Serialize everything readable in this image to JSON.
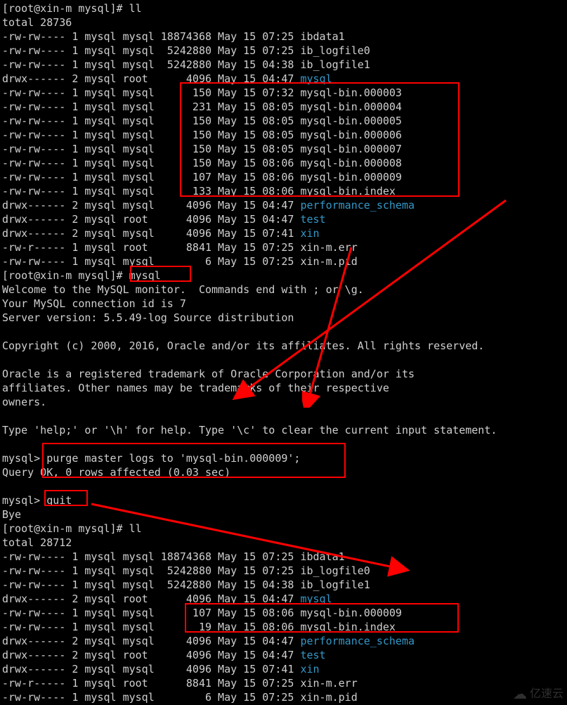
{
  "prompt1": "[root@xin-m mysql]# ll",
  "total1": "total 28736",
  "ls1": [
    {
      "perm": "-rw-rw----",
      "lnk": "1",
      "own": "mysql",
      "grp": "mysql",
      "size": "18874368",
      "date": "May 15 07:25",
      "name": "ibdata1",
      "dir": false
    },
    {
      "perm": "-rw-rw----",
      "lnk": "1",
      "own": "mysql",
      "grp": "mysql",
      "size": "5242880",
      "date": "May 15 07:25",
      "name": "ib_logfile0",
      "dir": false
    },
    {
      "perm": "-rw-rw----",
      "lnk": "1",
      "own": "mysql",
      "grp": "mysql",
      "size": "5242880",
      "date": "May 15 04:38",
      "name": "ib_logfile1",
      "dir": false
    },
    {
      "perm": "drwx------",
      "lnk": "2",
      "own": "mysql",
      "grp": "root",
      "size": "4096",
      "date": "May 15 04:47",
      "name": "mysql",
      "dir": true
    },
    {
      "perm": "-rw-rw----",
      "lnk": "1",
      "own": "mysql",
      "grp": "mysql",
      "size": "150",
      "date": "May 15 07:32",
      "name": "mysql-bin.000003",
      "dir": false
    },
    {
      "perm": "-rw-rw----",
      "lnk": "1",
      "own": "mysql",
      "grp": "mysql",
      "size": "231",
      "date": "May 15 08:05",
      "name": "mysql-bin.000004",
      "dir": false
    },
    {
      "perm": "-rw-rw----",
      "lnk": "1",
      "own": "mysql",
      "grp": "mysql",
      "size": "150",
      "date": "May 15 08:05",
      "name": "mysql-bin.000005",
      "dir": false
    },
    {
      "perm": "-rw-rw----",
      "lnk": "1",
      "own": "mysql",
      "grp": "mysql",
      "size": "150",
      "date": "May 15 08:05",
      "name": "mysql-bin.000006",
      "dir": false
    },
    {
      "perm": "-rw-rw----",
      "lnk": "1",
      "own": "mysql",
      "grp": "mysql",
      "size": "150",
      "date": "May 15 08:05",
      "name": "mysql-bin.000007",
      "dir": false
    },
    {
      "perm": "-rw-rw----",
      "lnk": "1",
      "own": "mysql",
      "grp": "mysql",
      "size": "150",
      "date": "May 15 08:06",
      "name": "mysql-bin.000008",
      "dir": false
    },
    {
      "perm": "-rw-rw----",
      "lnk": "1",
      "own": "mysql",
      "grp": "mysql",
      "size": "107",
      "date": "May 15 08:06",
      "name": "mysql-bin.000009",
      "dir": false
    },
    {
      "perm": "-rw-rw----",
      "lnk": "1",
      "own": "mysql",
      "grp": "mysql",
      "size": "133",
      "date": "May 15 08:06",
      "name": "mysql-bin.index",
      "dir": false
    },
    {
      "perm": "drwx------",
      "lnk": "2",
      "own": "mysql",
      "grp": "mysql",
      "size": "4096",
      "date": "May 15 04:47",
      "name": "performance_schema",
      "dir": true
    },
    {
      "perm": "drwx------",
      "lnk": "2",
      "own": "mysql",
      "grp": "root",
      "size": "4096",
      "date": "May 15 04:47",
      "name": "test",
      "dir": true
    },
    {
      "perm": "drwx------",
      "lnk": "2",
      "own": "mysql",
      "grp": "mysql",
      "size": "4096",
      "date": "May 15 07:41",
      "name": "xin",
      "dir": true
    },
    {
      "perm": "-rw-r-----",
      "lnk": "1",
      "own": "mysql",
      "grp": "root",
      "size": "8841",
      "date": "May 15 07:25",
      "name": "xin-m.err",
      "dir": false
    },
    {
      "perm": "-rw-rw----",
      "lnk": "1",
      "own": "mysql",
      "grp": "mysql",
      "size": "6",
      "date": "May 15 07:25",
      "name": "xin-m.pid",
      "dir": false
    }
  ],
  "prompt2_pre": "[root@xin-m mysql]# ",
  "prompt2_cmd": "mysql",
  "welcome": [
    "Welcome to the MySQL monitor.  Commands end with ; or \\g.",
    "Your MySQL connection id is 7",
    "Server version: 5.5.49-log Source distribution",
    "",
    "Copyright (c) 2000, 2016, Oracle and/or its affiliates. All rights reserved.",
    "",
    "Oracle is a registered trademark of Oracle Corporation and/or its",
    "affiliates. Other names may be trademarks of their respective",
    "owners.",
    "",
    "Type 'help;' or '\\h' for help. Type '\\c' to clear the current input statement.",
    ""
  ],
  "mysqlp1_pre": "mysql> ",
  "mysqlp1_cmd": "purge master logs to 'mysql-bin.000009';",
  "mysqlr1": "Query OK, 0 rows affected (0.03 sec)",
  "blank2": "",
  "mysqlp2_pre": "mysql> ",
  "mysqlp2_cmd": "quit",
  "bye": "Bye",
  "prompt3": "[root@xin-m mysql]# ll",
  "total2": "total 28712",
  "ls2": [
    {
      "perm": "-rw-rw----",
      "lnk": "1",
      "own": "mysql",
      "grp": "mysql",
      "size": "18874368",
      "date": "May 15 07:25",
      "name": "ibdata1",
      "dir": false
    },
    {
      "perm": "-rw-rw----",
      "lnk": "1",
      "own": "mysql",
      "grp": "mysql",
      "size": "5242880",
      "date": "May 15 07:25",
      "name": "ib_logfile0",
      "dir": false
    },
    {
      "perm": "-rw-rw----",
      "lnk": "1",
      "own": "mysql",
      "grp": "mysql",
      "size": "5242880",
      "date": "May 15 04:38",
      "name": "ib_logfile1",
      "dir": false
    },
    {
      "perm": "drwx------",
      "lnk": "2",
      "own": "mysql",
      "grp": "root",
      "size": "4096",
      "date": "May 15 04:47",
      "name": "mysql",
      "dir": true
    },
    {
      "perm": "-rw-rw----",
      "lnk": "1",
      "own": "mysql",
      "grp": "mysql",
      "size": "107",
      "date": "May 15 08:06",
      "name": "mysql-bin.000009",
      "dir": false
    },
    {
      "perm": "-rw-rw----",
      "lnk": "1",
      "own": "mysql",
      "grp": "mysql",
      "size": "19",
      "date": "May 15 08:06",
      "name": "mysql-bin.index",
      "dir": false
    },
    {
      "perm": "drwx------",
      "lnk": "2",
      "own": "mysql",
      "grp": "mysql",
      "size": "4096",
      "date": "May 15 04:47",
      "name": "performance_schema",
      "dir": true
    },
    {
      "perm": "drwx------",
      "lnk": "2",
      "own": "mysql",
      "grp": "root",
      "size": "4096",
      "date": "May 15 04:47",
      "name": "test",
      "dir": true
    },
    {
      "perm": "drwx------",
      "lnk": "2",
      "own": "mysql",
      "grp": "mysql",
      "size": "4096",
      "date": "May 15 07:41",
      "name": "xin",
      "dir": true
    },
    {
      "perm": "-rw-r-----",
      "lnk": "1",
      "own": "mysql",
      "grp": "root",
      "size": "8841",
      "date": "May 15 07:25",
      "name": "xin-m.err",
      "dir": false
    },
    {
      "perm": "-rw-rw----",
      "lnk": "1",
      "own": "mysql",
      "grp": "mysql",
      "size": "6",
      "date": "May 15 07:25",
      "name": "xin-m.pid",
      "dir": false
    }
  ],
  "watermark": "亿速云"
}
